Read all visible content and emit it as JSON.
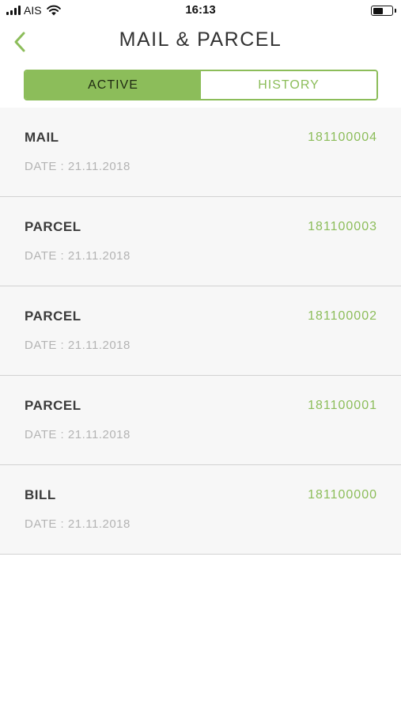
{
  "status_bar": {
    "carrier": "AIS",
    "time": "16:13",
    "icons": [
      "signal-icon",
      "wifi-icon",
      "battery-icon"
    ]
  },
  "nav": {
    "title": "MAIL & PARCEL",
    "back_icon": "chevron-left-icon"
  },
  "tabs": [
    {
      "label": "ACTIVE",
      "selected": true
    },
    {
      "label": "HISTORY",
      "selected": false
    }
  ],
  "items": [
    {
      "type": "MAIL",
      "number": "181100004",
      "date": "DATE : 21.11.2018"
    },
    {
      "type": "PARCEL",
      "number": "181100003",
      "date": "DATE : 21.11.2018"
    },
    {
      "type": "PARCEL",
      "number": "181100002",
      "date": "DATE : 21.11.2018"
    },
    {
      "type": "PARCEL",
      "number": "181100001",
      "date": "DATE : 21.11.2018"
    },
    {
      "type": "BILL",
      "number": "181100000",
      "date": "DATE : 21.11.2018"
    }
  ],
  "colors": {
    "accent": "#8cbd5a",
    "list_background": "#f7f7f7",
    "divider": "#d2d2d2",
    "muted_text": "#b4b4b4",
    "primary_text": "#3b3b3b"
  }
}
